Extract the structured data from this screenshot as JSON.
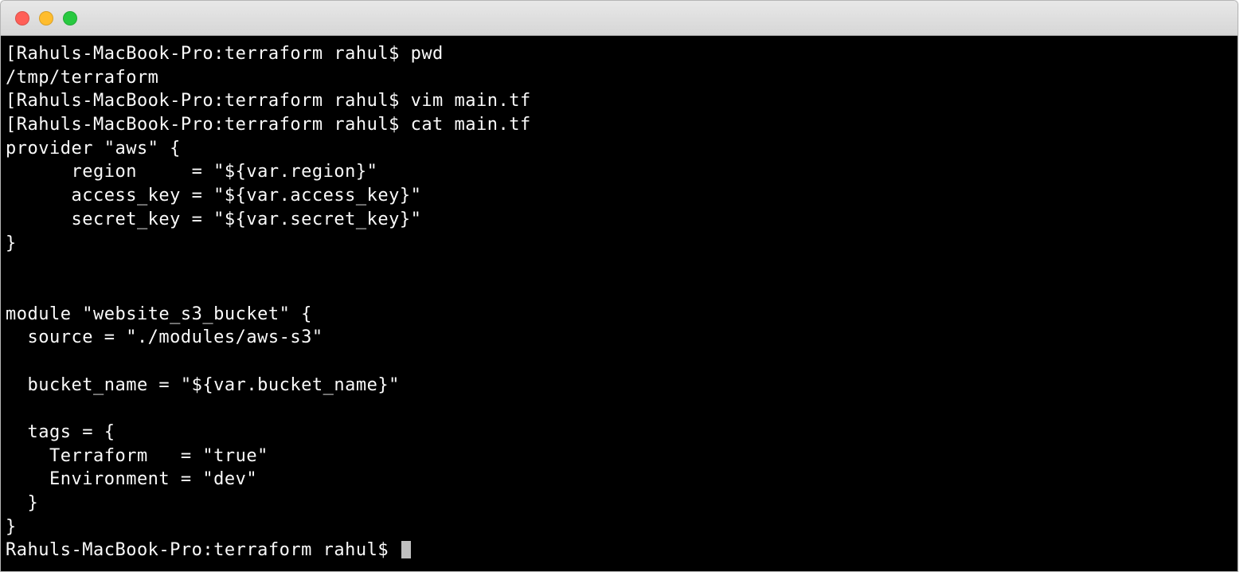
{
  "window": {
    "close": "close",
    "minimize": "minimize",
    "maximize": "maximize"
  },
  "terminal": {
    "lines": [
      "[Rahuls-MacBook-Pro:terraform rahul$ pwd",
      "/tmp/terraform",
      "[Rahuls-MacBook-Pro:terraform rahul$ vim main.tf",
      "[Rahuls-MacBook-Pro:terraform rahul$ cat main.tf",
      "provider \"aws\" {",
      "      region     = \"${var.region}\"",
      "      access_key = \"${var.access_key}\"",
      "      secret_key = \"${var.secret_key}\"",
      "}",
      "",
      "",
      "module \"website_s3_bucket\" {",
      "  source = \"./modules/aws-s3\"",
      "",
      "  bucket_name = \"${var.bucket_name}\"",
      "",
      "  tags = {",
      "    Terraform   = \"true\"",
      "    Environment = \"dev\"",
      "  }",
      "}"
    ],
    "prompt": "Rahuls-MacBook-Pro:terraform rahul$ "
  }
}
